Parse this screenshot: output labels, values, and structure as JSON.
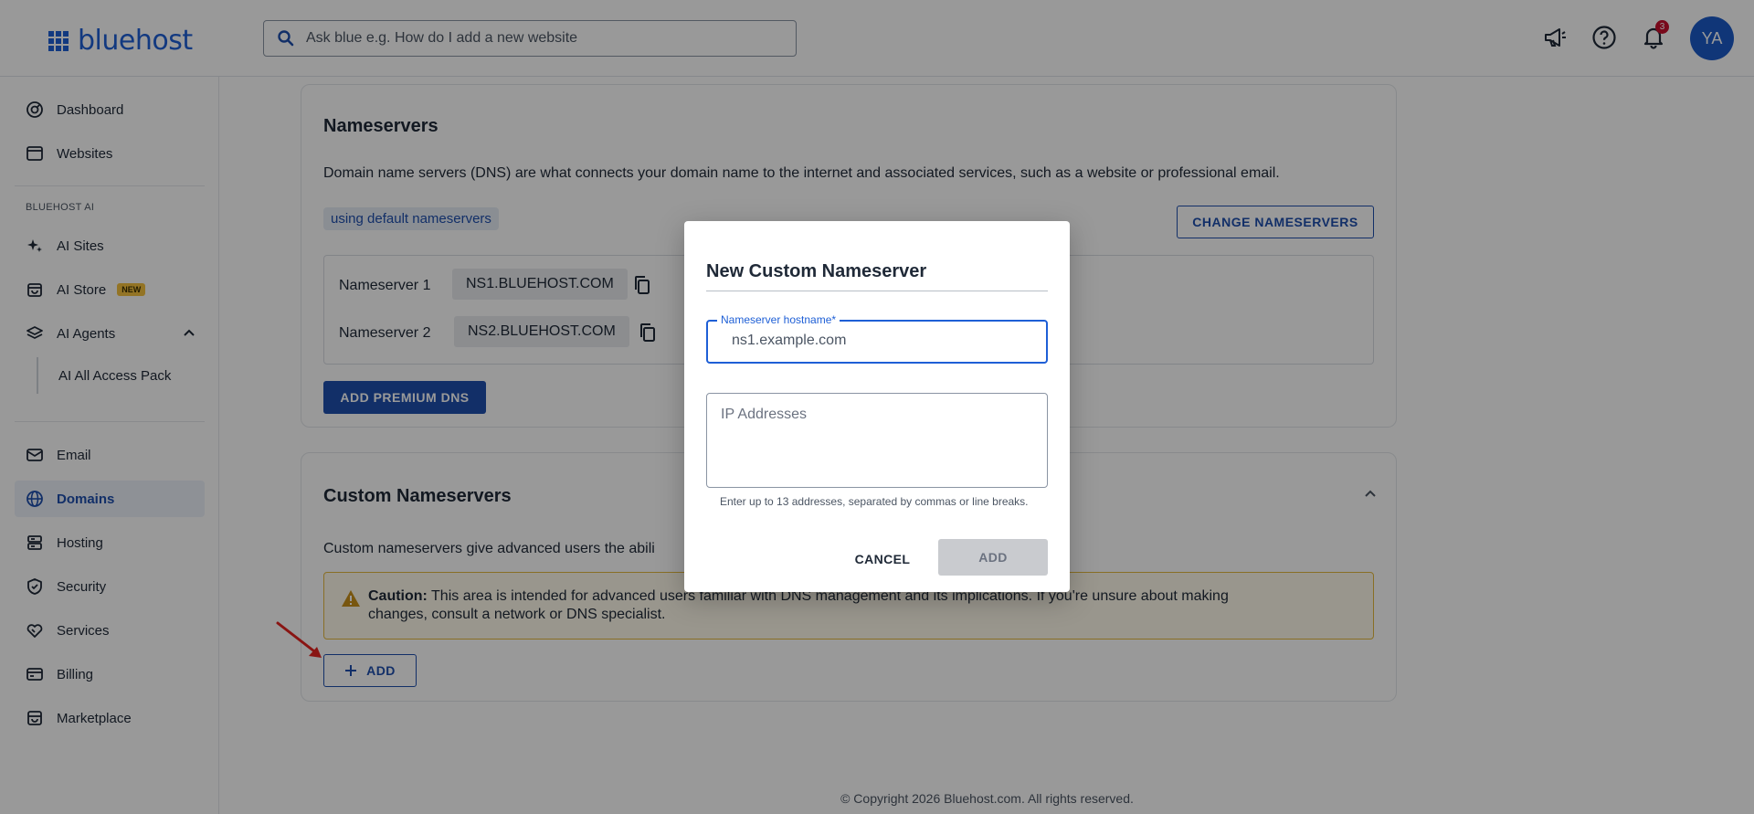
{
  "header": {
    "logo_text": "bluehost",
    "search_placeholder": "Ask blue e.g. How do I add a new website",
    "notification_count": "3",
    "avatar_initials": "YA"
  },
  "sidebar": {
    "items": [
      {
        "label": "Dashboard",
        "icon": "dashboard-icon"
      },
      {
        "label": "Websites",
        "icon": "browser-icon"
      }
    ],
    "ai_section_label": "BLUEHOST AI",
    "ai_items": [
      {
        "label": "AI Sites",
        "icon": "sparkle-icon"
      },
      {
        "label": "AI Store",
        "icon": "store-icon",
        "badge": "NEW"
      },
      {
        "label": "AI Agents",
        "icon": "layers-icon"
      }
    ],
    "ai_sub_item": "AI All Access Pack",
    "lower_items": [
      {
        "label": "Email",
        "icon": "mail-icon"
      },
      {
        "label": "Domains",
        "icon": "globe-icon",
        "active": true
      },
      {
        "label": "Hosting",
        "icon": "server-icon"
      },
      {
        "label": "Security",
        "icon": "shield-icon"
      },
      {
        "label": "Services",
        "icon": "handshake-icon"
      },
      {
        "label": "Billing",
        "icon": "card-icon"
      },
      {
        "label": "Marketplace",
        "icon": "shop-icon"
      }
    ]
  },
  "nameservers": {
    "title": "Nameservers",
    "description": "Domain name servers (DNS) are what connects your domain name to the internet and associated services, such as a website or professional email.",
    "status_chip": "using default nameservers",
    "change_button": "CHANGE NAMESERVERS",
    "rows": [
      {
        "label": "Nameserver 1",
        "value": "NS1.BLUEHOST.COM"
      },
      {
        "label": "Nameserver 2",
        "value": "NS2.BLUEHOST.COM"
      }
    ],
    "premium_button": "ADD PREMIUM DNS"
  },
  "custom_nameservers": {
    "title": "Custom Nameservers",
    "description": "Custom nameservers give advanced users the abili",
    "caution_label": "Caution:",
    "caution_text_line1": "This area is intended for advanced users familiar with DNS management and its implications. If you're unsure about making",
    "caution_text_line2": "changes, consult a network or DNS specialist.",
    "add_button": "ADD"
  },
  "footer": {
    "copyright": "© Copyright 2026 Bluehost.com. All rights reserved."
  },
  "modal": {
    "title": "New Custom Nameserver",
    "hostname_label": "Nameserver hostname",
    "hostname_required_mark": "*",
    "hostname_placeholder": "ns1.example.com",
    "ip_placeholder": "IP Addresses",
    "ip_helper": "Enter up to 13 addresses, separated by commas or line breaks.",
    "cancel_button": "CANCEL",
    "add_button": "ADD"
  },
  "colors": {
    "brand": "#1e5fd6",
    "primary_button": "#1e4fae",
    "caution_border": "#e5b93e",
    "notification": "#c8102e",
    "annotation_arrow": "#e52421"
  }
}
